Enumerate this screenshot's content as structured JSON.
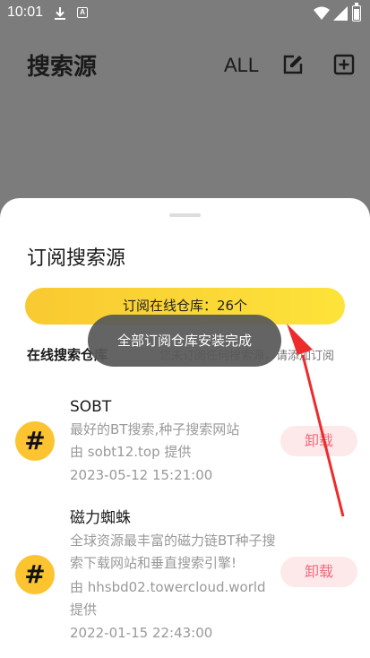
{
  "status_bar": {
    "time": "10:01",
    "icons": [
      "download-icon",
      "app-notification-icon",
      "wifi-icon",
      "signal-icon",
      "battery-icon"
    ]
  },
  "app_bar": {
    "title": "搜索源",
    "all_label": "ALL",
    "icons": [
      "edit-icon",
      "add-box-icon"
    ]
  },
  "sheet": {
    "title": "订阅搜索源",
    "repo_button": "订阅在线仓库：26个",
    "online_label": "在线搜索仓库",
    "empty_hint": "您未订阅任何搜索源，请添加订阅"
  },
  "toast": "全部订阅仓库安装完成",
  "sources": [
    {
      "icon": "#",
      "name": "SOBT",
      "desc": "最好的BT搜索,种子搜索网站",
      "by": "由 sobt12.top 提供",
      "date": "2023-05-12 15:21:00",
      "action": "卸载"
    },
    {
      "icon": "#",
      "name": "磁力蜘蛛",
      "desc": "全球资源最丰富的磁力链BT种子搜索下载网站和垂直搜索引擎!",
      "by": "由 hhsbd02.towercloud.world 提供",
      "date": "2022-01-15 22:43:00",
      "action": "卸载"
    }
  ],
  "colors": {
    "accent_yellow": "#fbc430",
    "uninstall_text": "#ee6b7d",
    "uninstall_bg": "#fde9ea",
    "annotation_arrow": "#ee2b2b"
  }
}
